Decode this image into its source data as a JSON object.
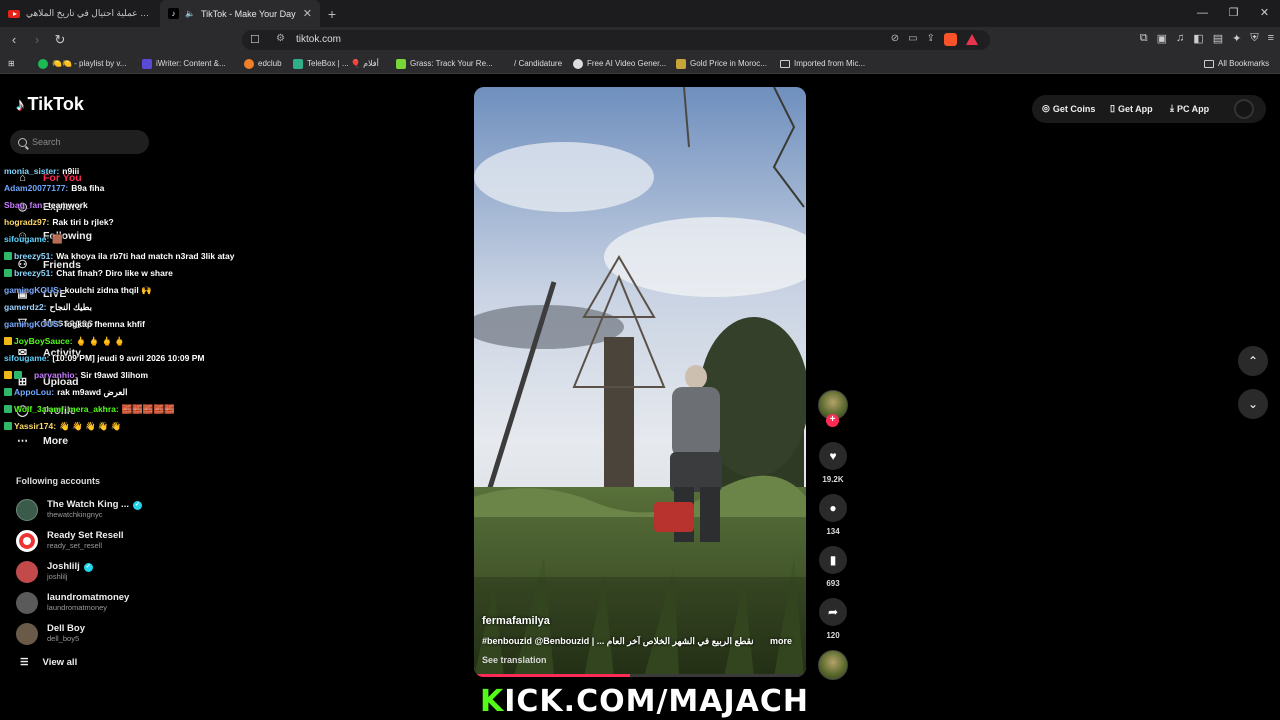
{
  "browser": {
    "tabs": [
      {
        "title": "اضخم عملية احتيال في تاريخ الملاهي !!",
        "active": false,
        "favicon": "youtube-icon"
      },
      {
        "title": "TikTok - Make Your Day",
        "active": true,
        "favicon": "tiktok-icon"
      }
    ],
    "url": "tiktok.com",
    "new_tab": "+",
    "bookmarks": [
      {
        "label": "🍋🍋 - playlist by v...",
        "icon": "spotify-icon",
        "color": "#1db954"
      },
      {
        "label": "iWriter: Content &...",
        "icon": "iwriter-icon",
        "color": "#5a4bd6"
      },
      {
        "label": "edclub",
        "icon": "edclub-icon",
        "color": "#f07f2a"
      },
      {
        "label": "TeleBox | ... 🎈 أفلام",
        "icon": "telebox-icon",
        "color": "#2fae8a"
      },
      {
        "label": "Grass: Track Your Re...",
        "icon": "grass-icon",
        "color": "#7ad53b"
      },
      {
        "label": "/ Candidature",
        "icon": "page-icon",
        "color": "#2b2b2e"
      },
      {
        "label": "Free AI Video Gener...",
        "icon": "ai-video-icon",
        "color": "#dddddd"
      },
      {
        "label": "Gold Price in Moroc...",
        "icon": "gold-price-icon",
        "color": "#c9a43a"
      },
      {
        "label": "Imported from Mic...",
        "icon": "folder-icon",
        "color": "#cccccc"
      }
    ],
    "all_bookmarks": "All Bookmarks"
  },
  "tiktok": {
    "logo": "TikTok",
    "search_placeholder": "Search",
    "nav": [
      {
        "label": "For You",
        "icon": "home-icon",
        "active": true
      },
      {
        "label": "Explore",
        "icon": "compass-icon"
      },
      {
        "label": "Following",
        "icon": "following-icon"
      },
      {
        "label": "Friends",
        "icon": "friends-icon"
      },
      {
        "label": "LIVE",
        "icon": "live-icon"
      },
      {
        "label": "Messages",
        "icon": "messages-icon"
      },
      {
        "label": "Activity",
        "icon": "activity-icon"
      },
      {
        "label": "Upload",
        "icon": "upload-icon"
      },
      {
        "label": "Profile",
        "icon": "profile-icon"
      },
      {
        "label": "More",
        "icon": "more-icon"
      }
    ],
    "following_header": "Following accounts",
    "following": [
      {
        "name": "The Watch King ...",
        "handle": "thewatchkingnyc",
        "verified": true,
        "color": "#3a5a4a"
      },
      {
        "name": "Ready Set Resell",
        "handle": "ready_set_resell",
        "verified": false,
        "color": "#ffffff"
      },
      {
        "name": "Joshlilj",
        "handle": "joshlilj",
        "verified": true,
        "color": "#c34a4a"
      },
      {
        "name": "laundromatmoney",
        "handle": "laundromatmoney",
        "verified": false,
        "color": "#5a5a5a"
      },
      {
        "name": "Dell Boy",
        "handle": "dell_boy5",
        "verified": false,
        "color": "#6a5a48"
      }
    ],
    "view_all": "View all",
    "top_actions": {
      "get_coins": "Get Coins",
      "get_app": "Get App",
      "pc_app": "PC App"
    },
    "video": {
      "author": "fermafamilya",
      "caption": "#benbouzid @Benbouzid | ... نقطع الربيع في الشهر الخلاص آخر العام",
      "more": "more",
      "see_translation": "See translation",
      "progress": 0.47
    },
    "actions": {
      "likes": "19.2K",
      "comments": "134",
      "saves": "693",
      "shares": "120"
    }
  },
  "chat_overlay": [
    {
      "user": "monia_sister:",
      "msg": "n9iii",
      "color": "#7fd7ff"
    },
    {
      "user": "Adam20077177:",
      "msg": "B9a fiha",
      "color": "#6fa8ff"
    },
    {
      "user": "Sbag_fan:",
      "msg": "teamwork",
      "color": "#c87bff"
    },
    {
      "user": "hogradz97:",
      "msg": "Rak tiri b rjlek?",
      "color": "#ffd966"
    },
    {
      "user": "sifougame:",
      "msg": "🟫",
      "color": "#5bd3ff"
    },
    {
      "user": "breezy51:",
      "msg": "Wa khoya ila rb7ti had match n3rad 3lik atay",
      "color": "#8bd8ff"
    },
    {
      "user": "breezy51:",
      "msg": "Chat finah? Diro like w share",
      "color": "#8bd8ff"
    },
    {
      "user": "gamingKOUS:",
      "msg": "koulchi zidna thqil 🙌",
      "color": "#7aa9ff"
    },
    {
      "user": "gamerdz2:",
      "msg": "بطيك النجاح",
      "color": "#9ad1ff"
    },
    {
      "user": "gamingKOUS:",
      "msg": "logkap fhemna khfif",
      "color": "#7aa9ff"
    },
    {
      "user": "JoyBoySauce:",
      "msg": "🖕 🖕 🖕 🖕",
      "color": "#53fc18"
    },
    {
      "user": "sifougame:",
      "msg": "[10:09 PM] jeudi 9 avril 2026 10:09 PM",
      "color": "#5bd3ff"
    },
    {
      "user": "parvanhio:",
      "msg": "Sir t9awd 3lihom",
      "color": "#c87bff"
    },
    {
      "user": "AppoLou:",
      "msg": "rak m9awd العرض",
      "color": "#6fa8ff"
    },
    {
      "user": "Wolf_3alami_mera_akhra:",
      "msg": "🧱🧱🧱🧱🧱",
      "color": "#53fc18"
    },
    {
      "user": "Yassir174:",
      "msg": "👋 👋 👋 👋 👋",
      "color": "#ffd966"
    }
  ],
  "stream_banner": {
    "k": "K",
    "rest": "ICK.COM/MAJACH"
  }
}
